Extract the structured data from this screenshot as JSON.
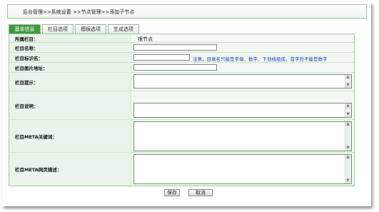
{
  "breadcrumb": "后台管理>>系统设置 >>节点管理>>添加子节点",
  "tabs": [
    {
      "label": "基本信息",
      "active": true
    },
    {
      "label": "栏目选项",
      "active": false
    },
    {
      "label": "模板选项",
      "active": false
    },
    {
      "label": "生成选项",
      "active": false
    }
  ],
  "form": {
    "parent_label": "所属栏目：",
    "parent_value": "根节点",
    "name_label": "栏目名称：",
    "name_value": "",
    "dir_label": "栏目标识名：",
    "dir_value": "",
    "dir_hint": "注意，目录名只能是字母、数字、下划线组成，首字符不能是数字",
    "image_label": "栏目图片地址：",
    "image_value": "",
    "tip_label": "栏目提示：",
    "desc_label": "栏目说明：",
    "keywords_label": "栏目META关键词：",
    "meta_desc_label": "栏目META网页描述："
  },
  "buttons": {
    "save": "保存",
    "cancel": "取消"
  },
  "colors": {
    "active_tab": "#3f9a3f",
    "label_bg": "#eaf4ea",
    "hint": "#1a3fbf"
  }
}
